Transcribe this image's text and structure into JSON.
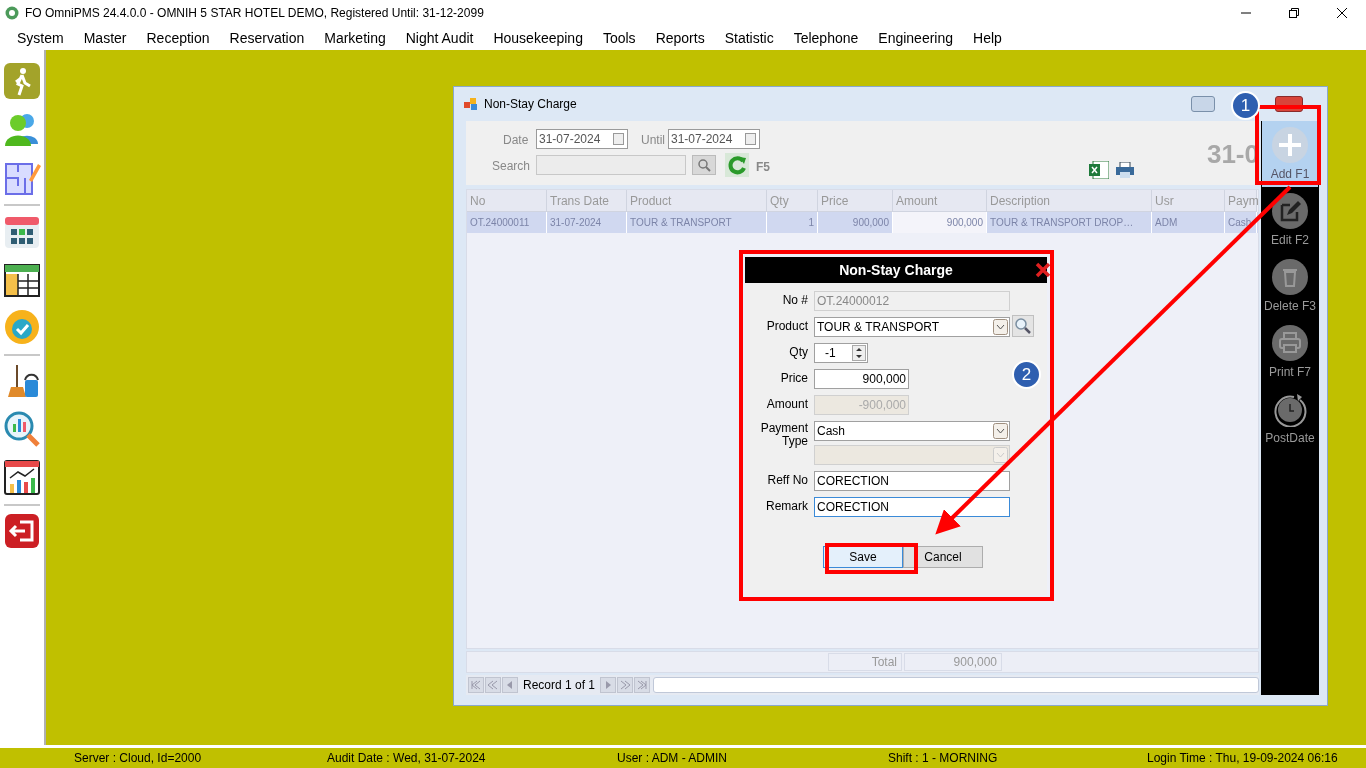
{
  "app": {
    "title": "FO OmniPMS 24.4.0.0 - OMNIH 5 STAR HOTEL DEMO, Registered Until: 31-12-2099"
  },
  "menu": [
    "System",
    "Master",
    "Reception",
    "Reservation",
    "Marketing",
    "Night Audit",
    "Housekeeping",
    "Tools",
    "Reports",
    "Statistic",
    "Telephone",
    "Engineering",
    "Help"
  ],
  "sidebar": [
    [
      {
        "kind": "walk"
      },
      {
        "kind": "guests"
      },
      {
        "kind": "floorplan"
      }
    ],
    [
      {
        "kind": "calendar"
      },
      {
        "kind": "year-calendar"
      },
      {
        "kind": "available"
      }
    ],
    [
      {
        "kind": "housekeeping"
      },
      {
        "kind": "analysis"
      },
      {
        "kind": "report"
      }
    ],
    [
      {
        "kind": "exit"
      }
    ]
  ],
  "window": {
    "title": "Non-Stay Charge",
    "filter": {
      "date_label": "Date",
      "date": "31-07-2024",
      "until_label": "Until",
      "until": "31-07-2024",
      "search_label": "Search",
      "refresh_key": "F5",
      "big_date": "31-0"
    },
    "table": {
      "columns": [
        "No",
        "Trans Date",
        "Product",
        "Qty",
        "Price",
        "Amount",
        "Description",
        "Usr",
        "Paym"
      ],
      "rows": [
        {
          "selected": true,
          "cells": [
            "OT.24000011",
            "31-07-2024",
            "TOUR & TRANSPORT",
            "1",
            "900,000",
            "900,000",
            "TOUR & TRANSPORT DROP…",
            "ADM",
            "Cash"
          ]
        }
      ]
    },
    "total": {
      "label": "Total",
      "value": "900,000"
    },
    "navigator": {
      "text": "Record 1 of 1"
    },
    "toolbar": [
      {
        "kind": "add",
        "label": "Add F1",
        "highlighted": true
      },
      {
        "kind": "edit",
        "label": "Edit F2",
        "highlighted": false
      },
      {
        "kind": "delete",
        "label": "Delete F3",
        "highlighted": false
      },
      {
        "kind": "print",
        "label": "Print F7",
        "highlighted": false
      },
      {
        "kind": "postdate",
        "label": "PostDate",
        "highlighted": false
      }
    ]
  },
  "dialog": {
    "title": "Non-Stay Charge",
    "fields": [
      {
        "kind": "readonly",
        "label": "No #",
        "value": "OT.24000012",
        "focused": false
      },
      {
        "kind": "combo",
        "label": "Product",
        "value": "TOUR & TRANSPORT",
        "focused": false
      },
      {
        "kind": "spin",
        "label": "Qty",
        "value": "-1",
        "focused": false
      },
      {
        "kind": "number",
        "label": "Price",
        "value": "900,000",
        "focused": false
      },
      {
        "kind": "readonly-number",
        "label": "Amount",
        "value": "-900,000",
        "focused": false
      },
      {
        "kind": "payment",
        "label": "Payment Type",
        "value": "Cash",
        "focused": false
      },
      {
        "kind": "text",
        "label": "Reff No",
        "value": "CORECTION",
        "focused": false
      },
      {
        "kind": "text",
        "label": "Remark",
        "value": "CORECTION",
        "focused": true
      }
    ],
    "buttons": [
      {
        "label": "Save",
        "default": true
      },
      {
        "label": "Cancel",
        "default": false
      }
    ]
  },
  "markers": [
    "1",
    "2"
  ],
  "status_bar": [
    "Server : Cloud, Id=2000",
    "Audit Date : Wed, 31-07-2024",
    "User : ADM - ADMIN",
    "Shift : 1 - MORNING",
    "Login Time : Thu, 19-09-2024 06:16"
  ]
}
